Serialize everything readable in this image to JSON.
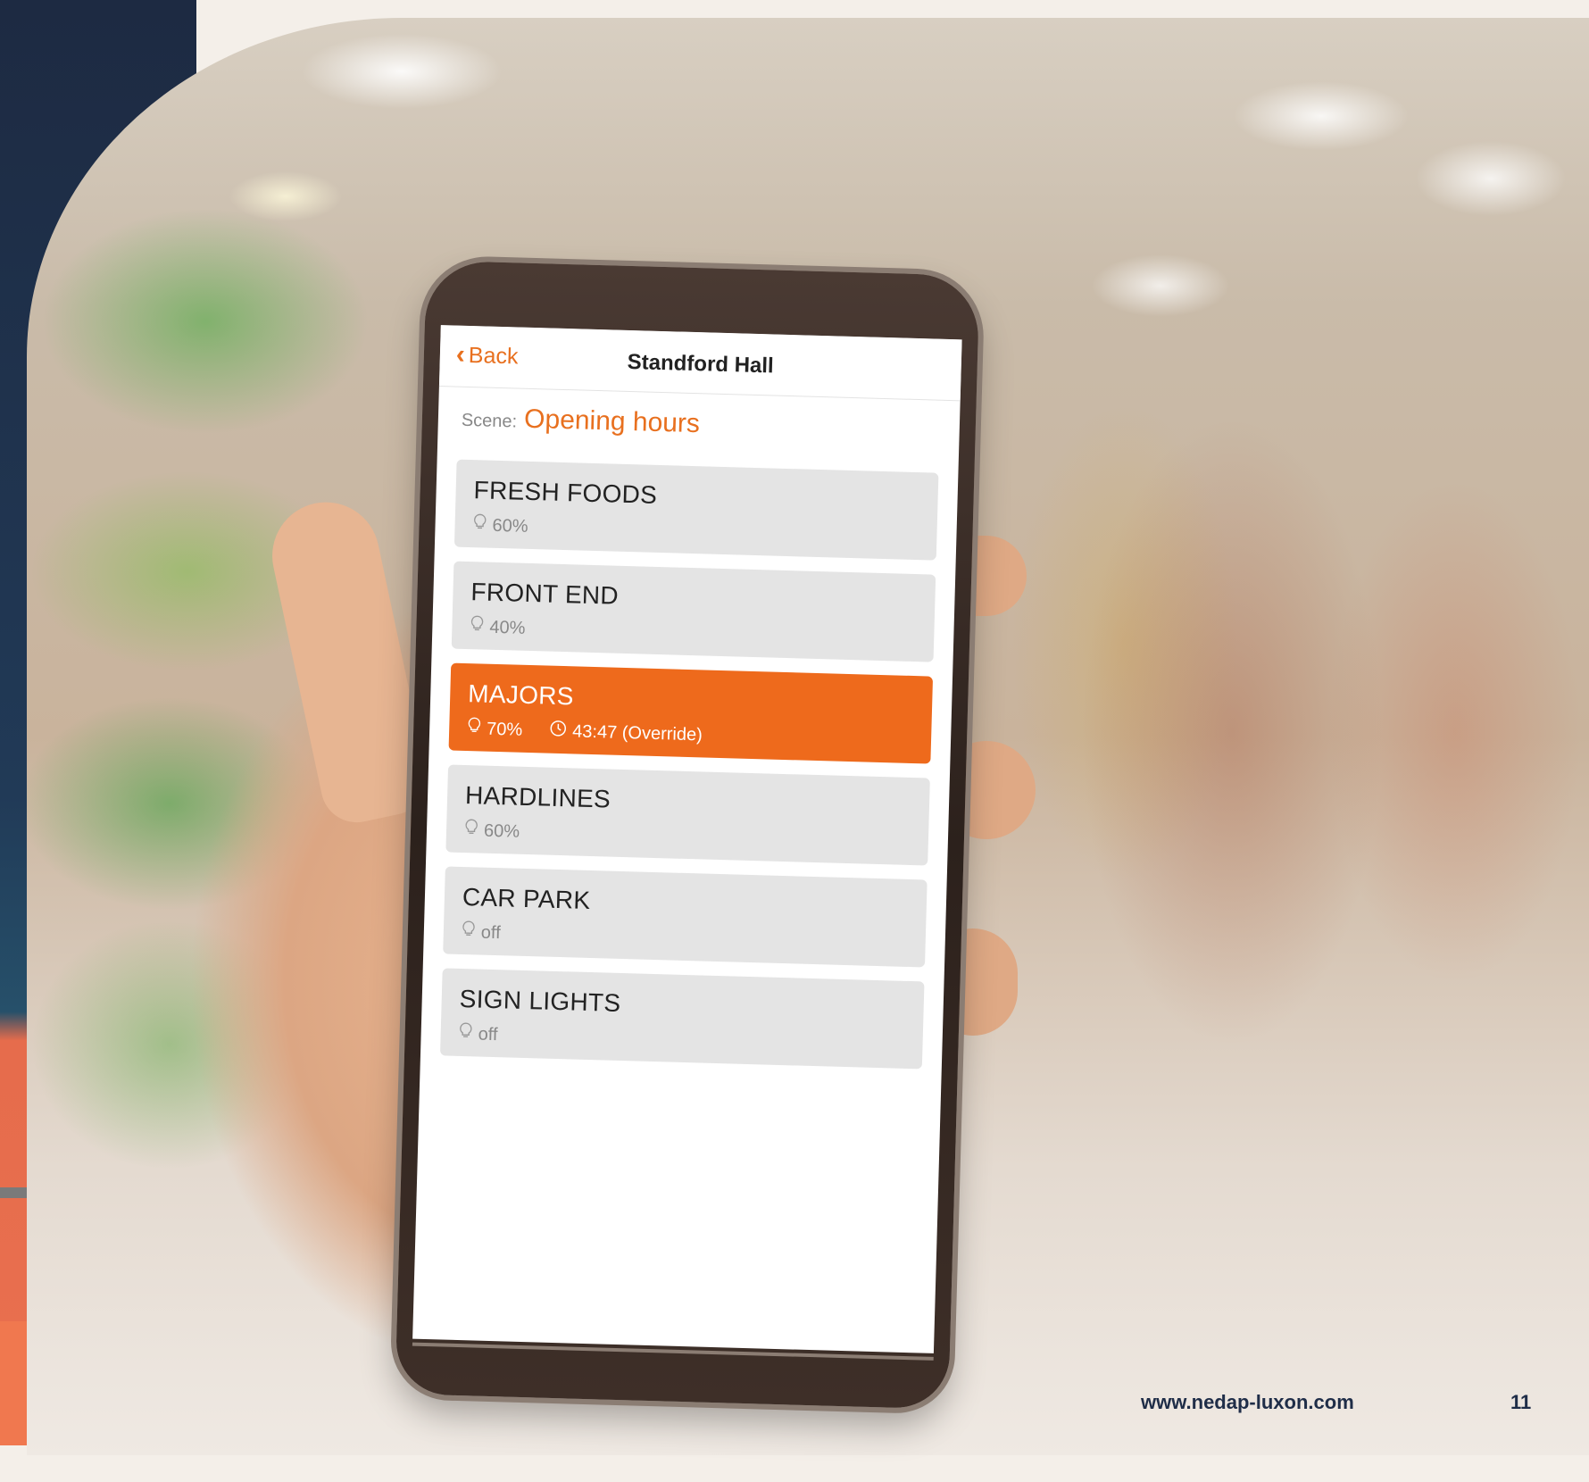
{
  "app": {
    "back_label": "Back",
    "title": "Standford Hall",
    "scene_label": "Scene:",
    "scene_value": "Opening hours"
  },
  "zones": [
    {
      "name": "FRESH FOODS",
      "level": "60%",
      "active": false
    },
    {
      "name": "FRONT END",
      "level": "40%",
      "active": false
    },
    {
      "name": "MAJORS",
      "level": "70%",
      "timer": "43:47 (Override)",
      "active": true
    },
    {
      "name": "HARDLINES",
      "level": "60%",
      "active": false
    },
    {
      "name": "CAR PARK",
      "level": "off",
      "active": false
    },
    {
      "name": "SIGN LIGHTS",
      "level": "off",
      "active": false
    }
  ],
  "footer": {
    "url": "www.nedap-luxon.com",
    "page": "11"
  },
  "colors": {
    "accent": "#e8701f",
    "active_row": "#ee6a1c",
    "row": "#e4e4e4",
    "navy": "#1f2d48"
  },
  "icons": {
    "back": "chevron-left-icon",
    "level": "lightbulb-icon",
    "timer": "clock-icon"
  }
}
